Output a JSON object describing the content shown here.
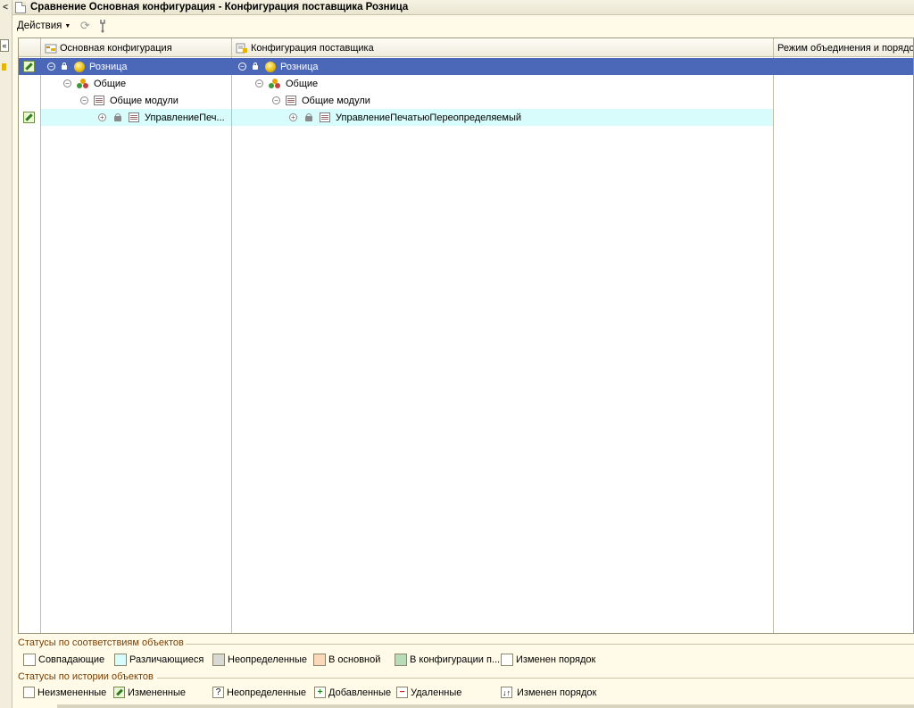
{
  "window": {
    "title": "Сравнение Основная конфигурация - Конфигурация поставщика Розница"
  },
  "toolbar": {
    "actions_label": "Действия"
  },
  "columns": {
    "main": "Основная конфигурация",
    "vendor": "Конфигурация поставщика",
    "merge_mode": "Режим объединения и порядок"
  },
  "rows": [
    {
      "main": "Розница",
      "vendor": "Розница"
    },
    {
      "main": "Общие",
      "vendor": "Общие"
    },
    {
      "main": "Общие модули",
      "vendor": "Общие модули"
    },
    {
      "main": "УправлениеПеч...",
      "vendor": "УправлениеПечатьюПереопределяемый"
    }
  ],
  "legend_match": {
    "title": "Статусы по соответствиям объектов",
    "items": [
      {
        "label": "Совпадающие",
        "color": "#ffffff"
      },
      {
        "label": "Различающиеся",
        "color": "#d8fbfb"
      },
      {
        "label": "Неопределенные",
        "color": "#d9d9d4"
      },
      {
        "label": "В основной",
        "color": "#fbd8b8"
      },
      {
        "label": "В конфигурации п...",
        "color": "#b8dcb8"
      },
      {
        "label": "Изменен порядок",
        "color": "#ffffff"
      }
    ]
  },
  "legend_history": {
    "title": "Статусы по истории объектов",
    "items": [
      {
        "label": "Неизмененные",
        "icon": "empty-box-icon"
      },
      {
        "label": "Измененные",
        "icon": "pencil-icon"
      },
      {
        "label": "Неопределенные",
        "icon": "question-icon"
      },
      {
        "label": "Добавленные",
        "icon": "plus-icon"
      },
      {
        "label": "Удаленные",
        "icon": "minus-icon"
      },
      {
        "label": "Изменен порядок",
        "icon": "order-arrows-icon"
      }
    ]
  }
}
